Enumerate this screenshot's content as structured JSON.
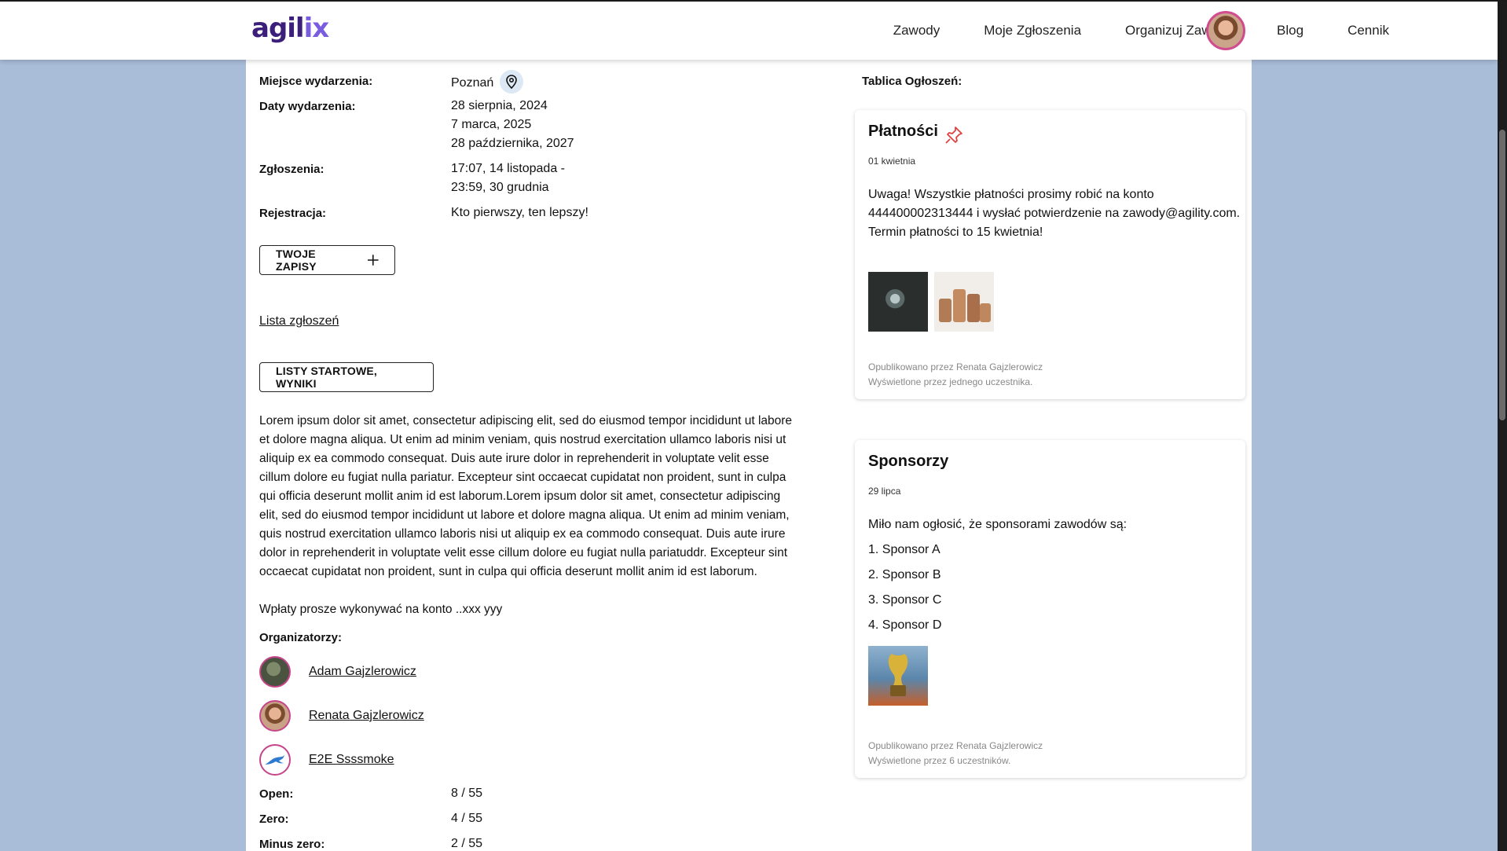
{
  "header": {
    "logo_main": "agil",
    "logo_accent": "ix",
    "nav": [
      "Zawody",
      "Moje Zgłoszenia",
      "Organizuj Zawody",
      "Blog",
      "Cennik"
    ]
  },
  "event": {
    "place_label": "Miejsce wydarzenia:",
    "place_value": "Poznań",
    "dates_label": "Daty wydarzenia:",
    "dates": [
      "28 sierpnia, 2024",
      "7 marca, 2025",
      "28 października, 2027"
    ],
    "signup_label": "Zgłoszenia:",
    "signup_lines": [
      "17:07, 14 listopada -",
      "23:59, 30 grudnia"
    ],
    "registration_label": "Rejestracja:",
    "registration_value": "Kto pierwszy, ten lepszy!",
    "my_entries_button": "TWOJE ZAPISY",
    "entries_list_link": "Lista zgłoszeń",
    "start_lists_button": "LISTY STARTOWE, WYNIKI",
    "description": "Lorem ipsum dolor sit amet, consectetur adipiscing elit, sed do eiusmod tempor incididunt ut labore et dolore magna aliqua. Ut enim ad minim veniam, quis nostrud exercitation ullamco laboris nisi ut aliquip ex ea commodo consequat. Duis aute irure dolor in reprehenderit in voluptate velit esse cillum dolore eu fugiat nulla pariatur. Excepteur sint occaecat cupidatat non proident, sunt in culpa qui officia deserunt mollit anim id est laborum.Lorem ipsum dolor sit amet, consectetur adipiscing elit, sed do eiusmod tempor incididunt ut labore et dolore magna aliqua. Ut enim ad minim veniam, quis nostrud exercitation ullamco laboris nisi ut aliquip ex ea commodo consequat. Duis aute irure dolor in reprehenderit in voluptate velit esse cillum dolore eu fugiat nulla pariatuddr. Excepteur sint occaecat cupidatat non proident, sunt in culpa qui officia deserunt mollit anim id est laborum.",
    "payment_note": "Wpłaty prosze wykonywać na konto ..xxx yyy",
    "organizers_label": "Organizatorzy:",
    "organizers": [
      "Adam Gajzlerowicz",
      "Renata Gajzlerowicz",
      "E2E Ssssmoke"
    ],
    "classes": [
      {
        "label": "Open:",
        "value": "8 / 55"
      },
      {
        "label": "Zero:",
        "value": "4 / 55"
      },
      {
        "label": "Minus zero:",
        "value": "2 / 55"
      }
    ]
  },
  "board": {
    "title": "Tablica Ogłoszeń:",
    "posts": [
      {
        "title": "Płatności",
        "date": "01 kwietnia",
        "lines": [
          "Uwaga! Wszystkie płatności prosimy robić na konto",
          "444400002313444 i wysłać potwierdzenie na zawody@agility.com.",
          "Termin płatności to 15 kwietnia!"
        ],
        "published": "Opublikowano przez Renata Gajzlerowicz",
        "viewed": "Wyświetlone przez jednego uczestnika."
      },
      {
        "title": "Sponsorzy",
        "date": "29 lipca",
        "intro": "Miło nam ogłosić, że sponsorami zawodów są:",
        "items": [
          "1. Sponsor A",
          "2. Sponsor B",
          "3. Sponsor C",
          "4. Sponsor D"
        ],
        "published": "Opublikowano przez Renata Gajzlerowicz",
        "viewed": "Wyświetlone przez 6 uczestników."
      }
    ]
  },
  "colors": {
    "accent": "#7a5ce0",
    "logo": "#3b1f7a",
    "background": "#a9bcd8",
    "pin": "#e23b3b"
  }
}
